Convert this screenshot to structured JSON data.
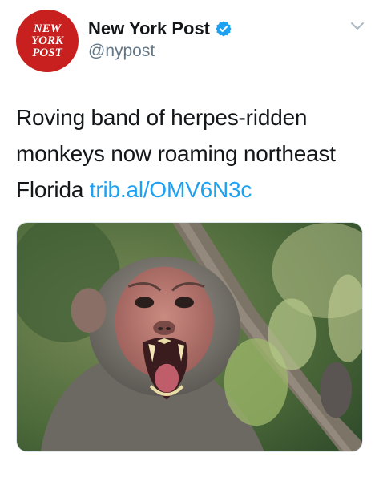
{
  "account": {
    "display_name": "New York Post",
    "handle": "@nypost",
    "verified": true,
    "avatar_logo_text": "NEW YORK POST",
    "avatar_color": "#c8201f"
  },
  "tweet": {
    "text": "Roving band of herpes-ridden monkeys now roaming northeast Florida",
    "link": "trib.al/OMV6N3c",
    "link_color": "#1da1f2"
  },
  "icons": {
    "verified": "verified-badge-icon",
    "menu": "chevron-down-icon"
  }
}
